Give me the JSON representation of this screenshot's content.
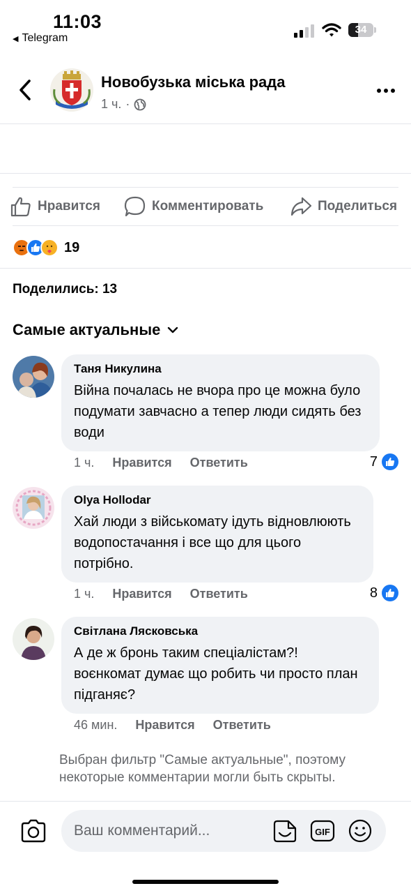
{
  "status_bar": {
    "time": "11:03",
    "back_app": "Telegram",
    "battery": "34"
  },
  "post": {
    "page_name": "Новобузька міська рада",
    "time_ago": "1 ч.",
    "separator": "·",
    "actions": {
      "like": "Нравится",
      "comment": "Комментировать",
      "share": "Поделиться"
    },
    "reactions_count": "19",
    "shares": "Поделились: 13"
  },
  "comments_section": {
    "sort_label": "Самые актуальные",
    "comments": [
      {
        "author": "Таня Никулина",
        "text": "Війна почалась не вчора про це можна було подумати завчасно а тепер люди сидять без води",
        "time": "1 ч.",
        "like_label": "Нравится",
        "reply_label": "Ответить",
        "likes": "7"
      },
      {
        "author": "Olya Hollodar",
        "text": "Хай люди з військомату ідуть відновлюють водопостачання і все що для цього потрібно.",
        "time": "1 ч.",
        "like_label": "Нравится",
        "reply_label": "Ответить",
        "likes": "8"
      },
      {
        "author": "Світлана Лясковська",
        "text": "А де ж бронь таким спеціалістам?! воєнкомат думає що робить чи просто план підганяє?",
        "time": "46 мин.",
        "like_label": "Нравится",
        "reply_label": "Ответить",
        "likes": ""
      }
    ],
    "filter_note": "Выбран фильтр \"Самые актуальные\", поэтому некоторые комментарии могли быть скрыты."
  },
  "composer": {
    "placeholder": "Ваш комментарий..."
  },
  "colors": {
    "accent": "#1877f2",
    "secondary_text": "#65676b",
    "bubble": "#f0f2f5"
  }
}
